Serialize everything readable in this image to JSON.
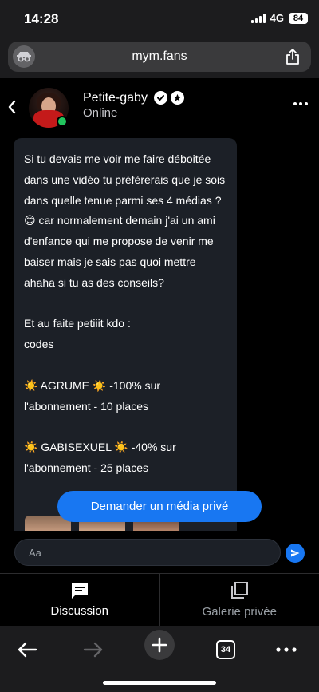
{
  "status_bar": {
    "time": "14:28",
    "network": "4G",
    "battery": "84"
  },
  "browser": {
    "url": "mym.fans",
    "tab_count": "34"
  },
  "chat": {
    "contact_name": "Petite-gaby",
    "contact_status": "Online",
    "message": "Si tu devais me voir me faire déboitée dans une vidéo tu préfèrerais que je sois dans quelle tenue parmi ses 4 médias ? 😊 car normalement demain j'ai un ami d'enfance qui me propose de venir me baiser mais je sais pas quoi mettre ahaha si tu as des conseils?\n\nEt au faite petiiit kdo :\ncodes\n\n☀️ AGRUME ☀️ -100% sur l'abonnement - 10 places\n\n☀️ GABISEXUEL ☀️ -40% sur l'abonnement - 25 places",
    "request_button": "Demander un média privé",
    "input_placeholder": "Aa"
  },
  "tabs": [
    {
      "label": "Discussion",
      "icon": "chat-icon",
      "active": true
    },
    {
      "label": "Galerie privée",
      "icon": "gallery-icon",
      "active": false
    }
  ],
  "colors": {
    "accent": "#1877f2",
    "online": "#22c55e",
    "bubble": "#1c2027"
  }
}
